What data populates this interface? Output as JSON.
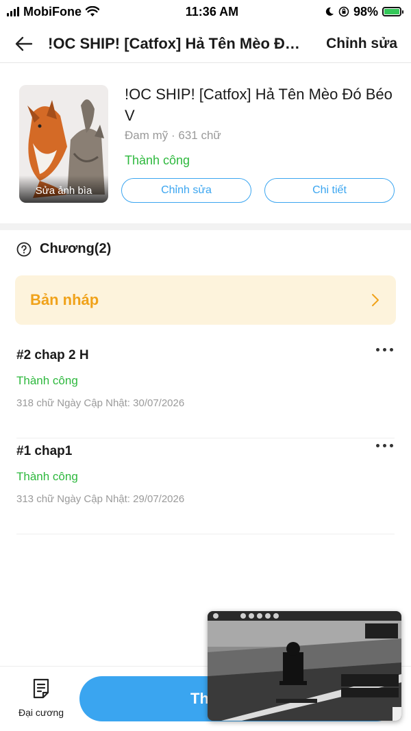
{
  "status_bar": {
    "carrier": "MobiFone",
    "time": "11:36 AM",
    "battery": "98%",
    "battery_level": 0.98
  },
  "nav": {
    "title": "!OC SHIP! [Catfox] Hả Tên Mèo Đó Béo V",
    "edit_label": "Chỉnh sửa"
  },
  "book": {
    "cover_label": "Sửa ảnh bìa",
    "title": "!OC SHIP! [Catfox] Hả Tên Mèo Đó Béo V",
    "meta": "Đam mỹ · 631 chữ",
    "status": "Thành công",
    "edit_button": "Chỉnh sửa",
    "detail_button": "Chi tiết"
  },
  "chapters_header": {
    "label": "Chương(2)"
  },
  "draft": {
    "label": "Bản nháp"
  },
  "chapters": [
    {
      "title": "#2 chap 2 H",
      "status": "Thành công",
      "meta": "318 chữ Ngày Cập Nhật: 30/07/2026"
    },
    {
      "title": "#1 chap1",
      "status": "Thành công",
      "meta": "313 chữ Ngày Cập Nhật: 29/07/2026"
    }
  ],
  "bottom": {
    "outline_label": "Đại cương",
    "publish_label": "Th"
  },
  "colors": {
    "accent": "#3aa5f0",
    "success": "#2db83d",
    "draft_text": "#f0a21a",
    "draft_bg": "#fdf3dc"
  }
}
